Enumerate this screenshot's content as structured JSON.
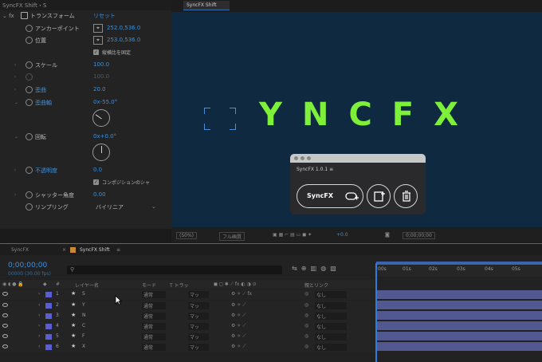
{
  "effect_controls": {
    "title": "SyncFX Shift・S",
    "transform_label": "トランスフォーム",
    "reset_label": "リセット",
    "rows": [
      {
        "label": "アンカーポイント",
        "value": "252.0,536.0"
      },
      {
        "label": "位置",
        "value": "253.0,536.0"
      },
      {
        "label": "縦横比を固定",
        "value": ""
      },
      {
        "label": "スケール",
        "value": "100.0"
      },
      {
        "label": "",
        "value": "100.0"
      },
      {
        "label": "歪曲",
        "value": "20.0"
      },
      {
        "label": "歪曲軸",
        "value": "0x-55.0°"
      },
      {
        "label": "回転",
        "value": "0x+0.0°"
      },
      {
        "label": "不透明度",
        "value": "0.0"
      },
      {
        "label": "コンポジションのシャ",
        "value": ""
      },
      {
        "label": "シャッター角度",
        "value": "0.00"
      },
      {
        "label": "リンプリング",
        "value": "バイリニア"
      }
    ]
  },
  "viewer": {
    "tab": "SyncFX Shift",
    "headline": "YNCFX",
    "toolbar": {
      "zoom": "(50%)",
      "resolution": "フル画質",
      "exposure": "+0.0",
      "time": "0;00;00;00"
    }
  },
  "plugin": {
    "name": "SyncFX 1.0.1",
    "main_button": "SyncFX"
  },
  "timeline": {
    "tabs": [
      "SyncFX",
      "SyncFX Shift"
    ],
    "timecode": "0;00;00;00",
    "timecode_sub": "00000 (30.00 fps)",
    "columns": {
      "layer_name": "レイヤー名",
      "mode": "モード",
      "trkmat": "T トラッ",
      "parent": "親とリンク"
    },
    "ruler_ticks": [
      "00s",
      "01s",
      "02s",
      "03s",
      "04s",
      "05s"
    ],
    "layers": [
      {
        "num": "1",
        "name": "S",
        "mode": "通常",
        "track": "マッ",
        "parent": "なし"
      },
      {
        "num": "2",
        "name": "Y",
        "mode": "通常",
        "track": "マッ",
        "parent": "なし"
      },
      {
        "num": "3",
        "name": "N",
        "mode": "通常",
        "track": "マッ",
        "parent": "なし"
      },
      {
        "num": "4",
        "name": "C",
        "mode": "通常",
        "track": "マッ",
        "parent": "なし"
      },
      {
        "num": "5",
        "name": "F",
        "mode": "通常",
        "track": "マッ",
        "parent": "なし"
      },
      {
        "num": "6",
        "name": "X",
        "mode": "通常",
        "track": "マッ",
        "parent": "なし"
      }
    ]
  },
  "colors": {
    "accent": "#3e8fd8",
    "title_green": "#7ef03a",
    "label_purple": "#5a5fd0",
    "stage": "#0e2940"
  }
}
